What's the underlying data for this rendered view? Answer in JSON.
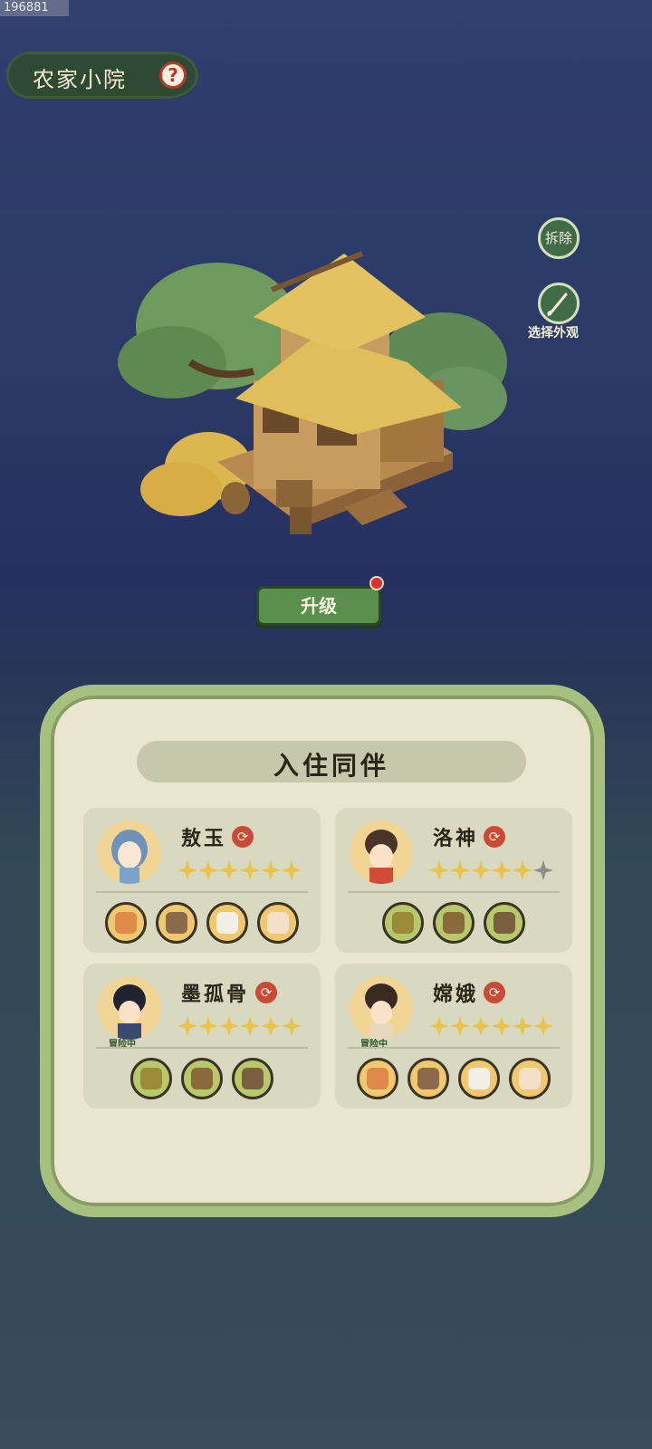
{
  "top_id": "196881",
  "title": "农家小院",
  "buttons": {
    "demolish": "拆除",
    "appearance_label": "选择外观",
    "upgrade": "升级"
  },
  "panel_title": "入住同伴",
  "companions": [
    {
      "name": "敖玉",
      "stars": 6,
      "max_stars": 6,
      "status": "",
      "skill_theme": "gold",
      "skills": 4
    },
    {
      "name": "洛神",
      "stars": 5,
      "max_stars": 6,
      "status": "",
      "skill_theme": "green",
      "skills": 3
    },
    {
      "name": "墨孤骨",
      "stars": 6,
      "max_stars": 6,
      "status": "冒险中",
      "skill_theme": "green",
      "skills": 3
    },
    {
      "name": "嫦娥",
      "stars": 6,
      "max_stars": 6,
      "status": "冒险中",
      "skill_theme": "gold",
      "skills": 4
    }
  ],
  "icons": {
    "help": "question-icon",
    "swap": "swap-icon",
    "brush": "brush-icon"
  },
  "colors": {
    "accent_green": "#5b8f4e",
    "panel_border": "#a8c07f",
    "notice_red": "#d9322b",
    "star_gold": "#e9c44a"
  }
}
